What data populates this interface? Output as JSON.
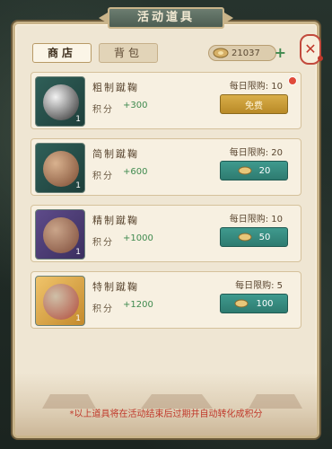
{
  "title": "活动道具",
  "tabs": [
    {
      "label": "商店",
      "active": true
    },
    {
      "label": "背包",
      "active": false
    }
  ],
  "currency": {
    "amount": "21037",
    "icon": "coin-icon",
    "plus_label": "+"
  },
  "close_label": "✕",
  "items": [
    {
      "name": "粗制蹴鞠",
      "score_label": "积分",
      "score_value": "+300",
      "limit": "每日限购: 10",
      "qty": "1",
      "button_label": "免费",
      "button_type": "gold",
      "has_red_dot": true,
      "ball_colors": [
        "#f2f2f2",
        "#2a2a2a"
      ]
    },
    {
      "name": "简制蹴鞠",
      "score_label": "积分",
      "score_value": "+600",
      "limit": "每日限购: 20",
      "qty": "1",
      "button_label": "20",
      "button_type": "green",
      "has_red_dot": false,
      "ball_colors": [
        "#d9b28f",
        "#7b4a31"
      ]
    },
    {
      "name": "精制蹴鞠",
      "score_label": "积分",
      "score_value": "+1000",
      "limit": "每日限购: 10",
      "qty": "1",
      "button_label": "50",
      "button_type": "green",
      "has_red_dot": false,
      "ball_colors": [
        "#caa58a",
        "#7e4c3a"
      ]
    },
    {
      "name": "特制蹴鞠",
      "score_label": "积分",
      "score_value": "+1200",
      "limit": "每日限购: 5",
      "qty": "1",
      "button_label": "100",
      "button_type": "green",
      "has_red_dot": false,
      "ball_colors": [
        "#cfc0a8",
        "#b24c3d"
      ]
    }
  ],
  "footnote": "*以上道具将在活动结束后过期并自动转化成积分",
  "colors": {
    "panel_bg": "#efe6d3",
    "accent_green": "#3f9a8e",
    "accent_gold": "#d9ae49",
    "score_green": "#3f8a4e",
    "warning_red": "#c0392b"
  }
}
